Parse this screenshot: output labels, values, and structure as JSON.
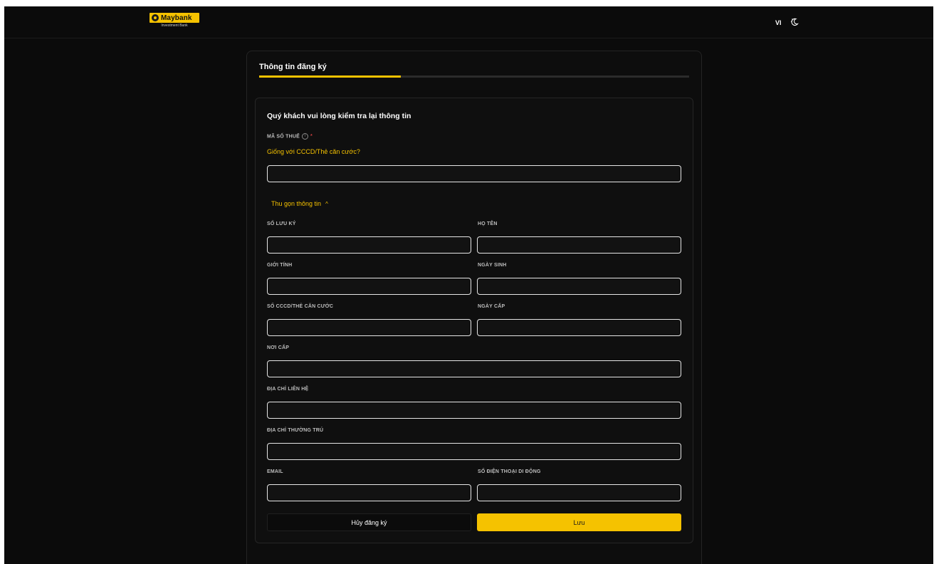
{
  "header": {
    "brand_name": "Maybank",
    "brand_sub": "Investment Bank",
    "language": "VI",
    "theme_icon": "theme-toggle-icon"
  },
  "page": {
    "title": "Thông tin đăng ký",
    "progress": 0.33
  },
  "form": {
    "heading": "Quý khách vui lòng kiểm tra lại thông tin",
    "tax_label": "Mã số thuế",
    "tax_info_icon": "i",
    "tax_required": "*",
    "tax_same_link": "Giống với CCCD/Thẻ căn cước?",
    "tax_value": "",
    "collapse_label": "Thu gọn thông tin",
    "collapse_icon": "^",
    "fields": {
      "depository_no": {
        "label": "Số lưu ký",
        "value": ""
      },
      "full_name": {
        "label": "Họ tên",
        "value": ""
      },
      "gender": {
        "label": "Giới tính",
        "value": ""
      },
      "dob": {
        "label": "Ngày sinh",
        "value": ""
      },
      "id_no": {
        "label": "Số CCCD/Thẻ căn cước",
        "value": ""
      },
      "issue_date": {
        "label": "Ngày cấp",
        "value": ""
      },
      "issue_place": {
        "label": "Nơi cấp",
        "value": ""
      },
      "contact_address": {
        "label": "Địa chỉ liên hệ",
        "value": ""
      },
      "permanent_address": {
        "label": "Địa chỉ thường trú",
        "value": ""
      },
      "email": {
        "label": "Email",
        "value": ""
      },
      "mobile": {
        "label": "Số điện thoại di động",
        "value": ""
      }
    },
    "cancel_label": "Hủy đăng ký",
    "save_label": "Lưu"
  },
  "colors": {
    "accent": "#f5c200",
    "background": "#0b0b0b",
    "required": "#d04040"
  }
}
